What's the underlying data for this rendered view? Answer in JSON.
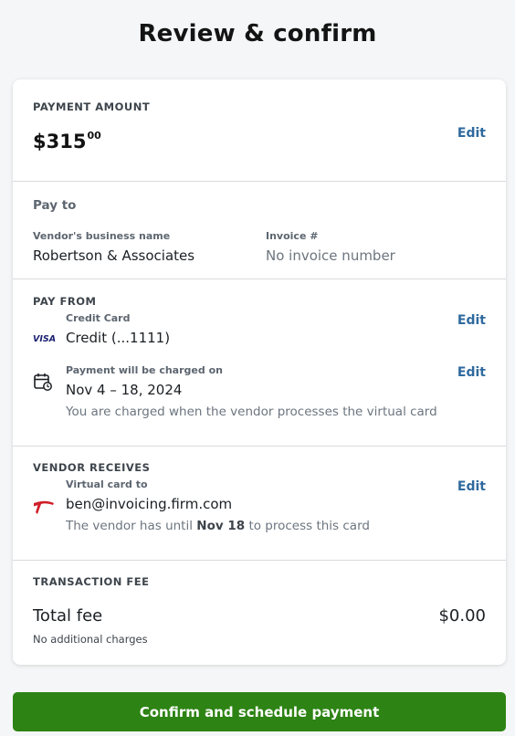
{
  "page": {
    "title": "Review & confirm"
  },
  "payment_amount": {
    "heading": "PAYMENT AMOUNT",
    "dollars": "$315",
    "cents": "00",
    "edit_label": "Edit"
  },
  "pay_to": {
    "heading": "Pay to",
    "vendor_label": "Vendor's business name",
    "vendor_value": "Robertson & Associates",
    "invoice_label": "Invoice #",
    "invoice_value": "No invoice number"
  },
  "pay_from": {
    "heading": "PAY FROM",
    "card_brand": "VISA",
    "card_label": "Credit Card",
    "card_value": "Credit (...1111)",
    "card_edit": "Edit",
    "charge_label": "Payment will be charged on",
    "charge_value": "Nov 4 – 18, 2024",
    "charge_note": "You are charged when the vendor processes the virtual card",
    "charge_edit": "Edit",
    "card_icon": "visa-icon",
    "charge_icon": "calendar-clock-icon"
  },
  "vendor_receives": {
    "heading": "VENDOR RECEIVES",
    "method_label": "Virtual card to",
    "method_value": "ben@invoicing.firm.com",
    "note_prefix": "The vendor has until ",
    "note_date": "Nov 18",
    "note_suffix": " to process this card",
    "edit_label": "Edit",
    "icon": "capital-one-swoosh-icon"
  },
  "transaction_fee": {
    "heading": "TRANSACTION FEE",
    "total_label": "Total fee",
    "total_value": "$0.00",
    "note": "No additional charges"
  },
  "confirm_button": {
    "label": "Confirm and schedule payment"
  },
  "colors": {
    "accent_link": "#2f6a9e",
    "confirm_green": "#2d8314",
    "brand_red": "#d0202a",
    "visa_blue": "#1a1f71"
  }
}
